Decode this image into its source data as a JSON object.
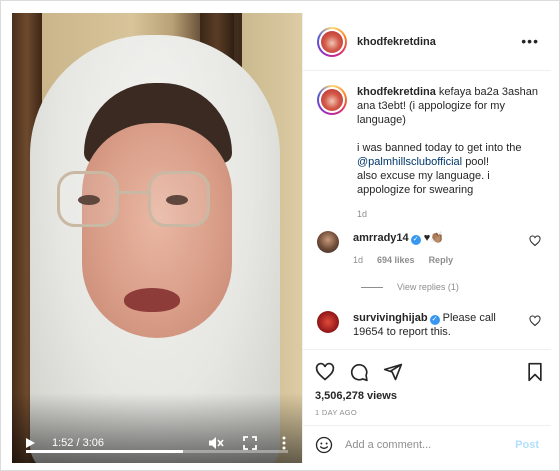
{
  "video": {
    "time": "1:52 / 3:06",
    "progress": 0.6
  },
  "post": {
    "username": "khodfekretdina",
    "more_label": "•••"
  },
  "caption": {
    "username": "khodfekretdina",
    "line1": "kefaya ba2a 3ashan ana t3ebt! (i appologize for my language)",
    "para2_pre": "i was banned today to get into the",
    "mention": "@palmhillsclubofficial",
    "para2_post": "pool!",
    "para2_line2": "also excuse my language. i appologize for swearing",
    "age": "1d"
  },
  "comments": [
    {
      "username": "amrrady14",
      "text": "♥👏🏽",
      "age": "1d",
      "likes": "694 likes",
      "reply": "Reply",
      "view_replies": "View replies (1)"
    },
    {
      "username": "survivinghijab",
      "text": "Please call 19654 to report this."
    }
  ],
  "footer": {
    "views": "3,506,278 views",
    "posted": "1 DAY AGO",
    "comment_placeholder": "Add a comment...",
    "post_label": "Post"
  },
  "colors": {
    "link": "#00376b",
    "verified": "#3897f0",
    "post_disabled": "#b2dffc",
    "muted": "#8e8e8e"
  }
}
